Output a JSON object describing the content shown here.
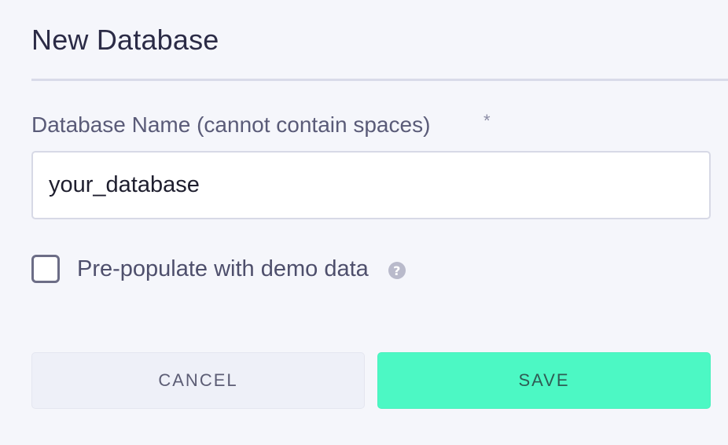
{
  "dialog": {
    "title": "New Database",
    "field": {
      "label": "Database Name (cannot contain spaces)",
      "required_marker": "*",
      "value": "your_database"
    },
    "checkbox": {
      "label": "Pre-populate with demo data",
      "checked": false,
      "help_icon": "question-circle-icon",
      "help_glyph": "?"
    },
    "buttons": {
      "cancel_label": "CANCEL",
      "save_label": "SAVE"
    }
  },
  "colors": {
    "background": "#f5f6fb",
    "save_accent": "#4cf8c4",
    "cancel_bg": "#eef0f8"
  }
}
